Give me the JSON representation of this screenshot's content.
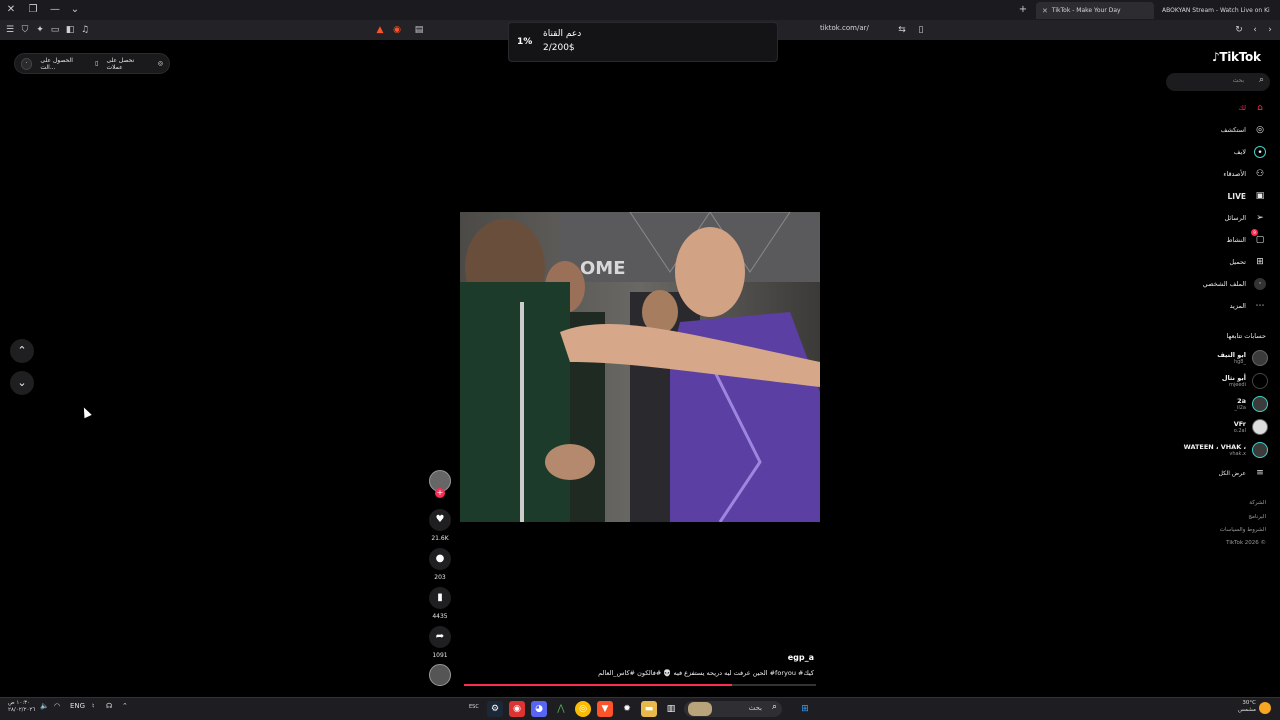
{
  "browser": {
    "tabs": [
      {
        "label": "TikTok - Make Your Day",
        "active": true
      },
      {
        "label": "ABOKYAN Stream - Watch Live on Ki",
        "active": false
      }
    ],
    "url": "tiktok.com/ar/"
  },
  "donation": {
    "percent": "1%",
    "title": "دعم القناة",
    "amount": "2/200$"
  },
  "extension_pill": {
    "item1": "نحصل على عملات",
    "item2": "الحصول على الت..."
  },
  "sidebar": {
    "logo": "TikTok",
    "search_placeholder": "بحث",
    "nav": [
      {
        "label": "لك",
        "icon": "home-icon"
      },
      {
        "label": "استكشف",
        "icon": "compass-icon"
      },
      {
        "label": "لايف",
        "icon": "live-user-icon"
      },
      {
        "label": "الأصدقاء",
        "icon": "friends-icon"
      },
      {
        "label": "LIVE",
        "icon": "live-tv-icon"
      },
      {
        "label": "الرسائل",
        "icon": "send-icon"
      },
      {
        "label": "النشاط",
        "icon": "inbox-icon"
      },
      {
        "label": "تحميل",
        "icon": "upload-icon"
      },
      {
        "label": "الملف الشخصي",
        "icon": "profile-icon"
      },
      {
        "label": "المزيد",
        "icon": "more-icon"
      }
    ],
    "activity_badge": "9",
    "following_title": "حسابات تتابعها",
    "following": [
      {
        "name": "ابو النيف",
        "handle": "hg8_"
      },
      {
        "name": "أبو نثال",
        "handle": "mjeedi"
      },
      {
        "name": "2a",
        "handle": "_il2a"
      },
      {
        "name": "VFr",
        "handle": "o.2al"
      },
      {
        "name": "WATEEN ، VHAK ،",
        "handle": "vhak.x"
      }
    ],
    "see_all": "عرض الكل",
    "footer": [
      "الشركة",
      "البرنامج",
      "الشروط والسياسات",
      "TikTok 2026 ©"
    ]
  },
  "video": {
    "author": "egp_a",
    "caption": "الحين عرفت ليه دريحه يستفزع فيه 💀 #فالكون #كاس_العالم #foryou #كيك",
    "likes": "21.6K",
    "comments": "203",
    "saves": "4435",
    "shares": "1091",
    "progress": 0.76
  },
  "taskbar": {
    "lang": "ENG",
    "search_label": "بحث",
    "time": "١٠:٣٠ ص",
    "date": "٢٨/٠٢/٢٠٢٦",
    "weather_temp": "30°C",
    "weather_desc": "مشمس",
    "esc": "ESC"
  }
}
